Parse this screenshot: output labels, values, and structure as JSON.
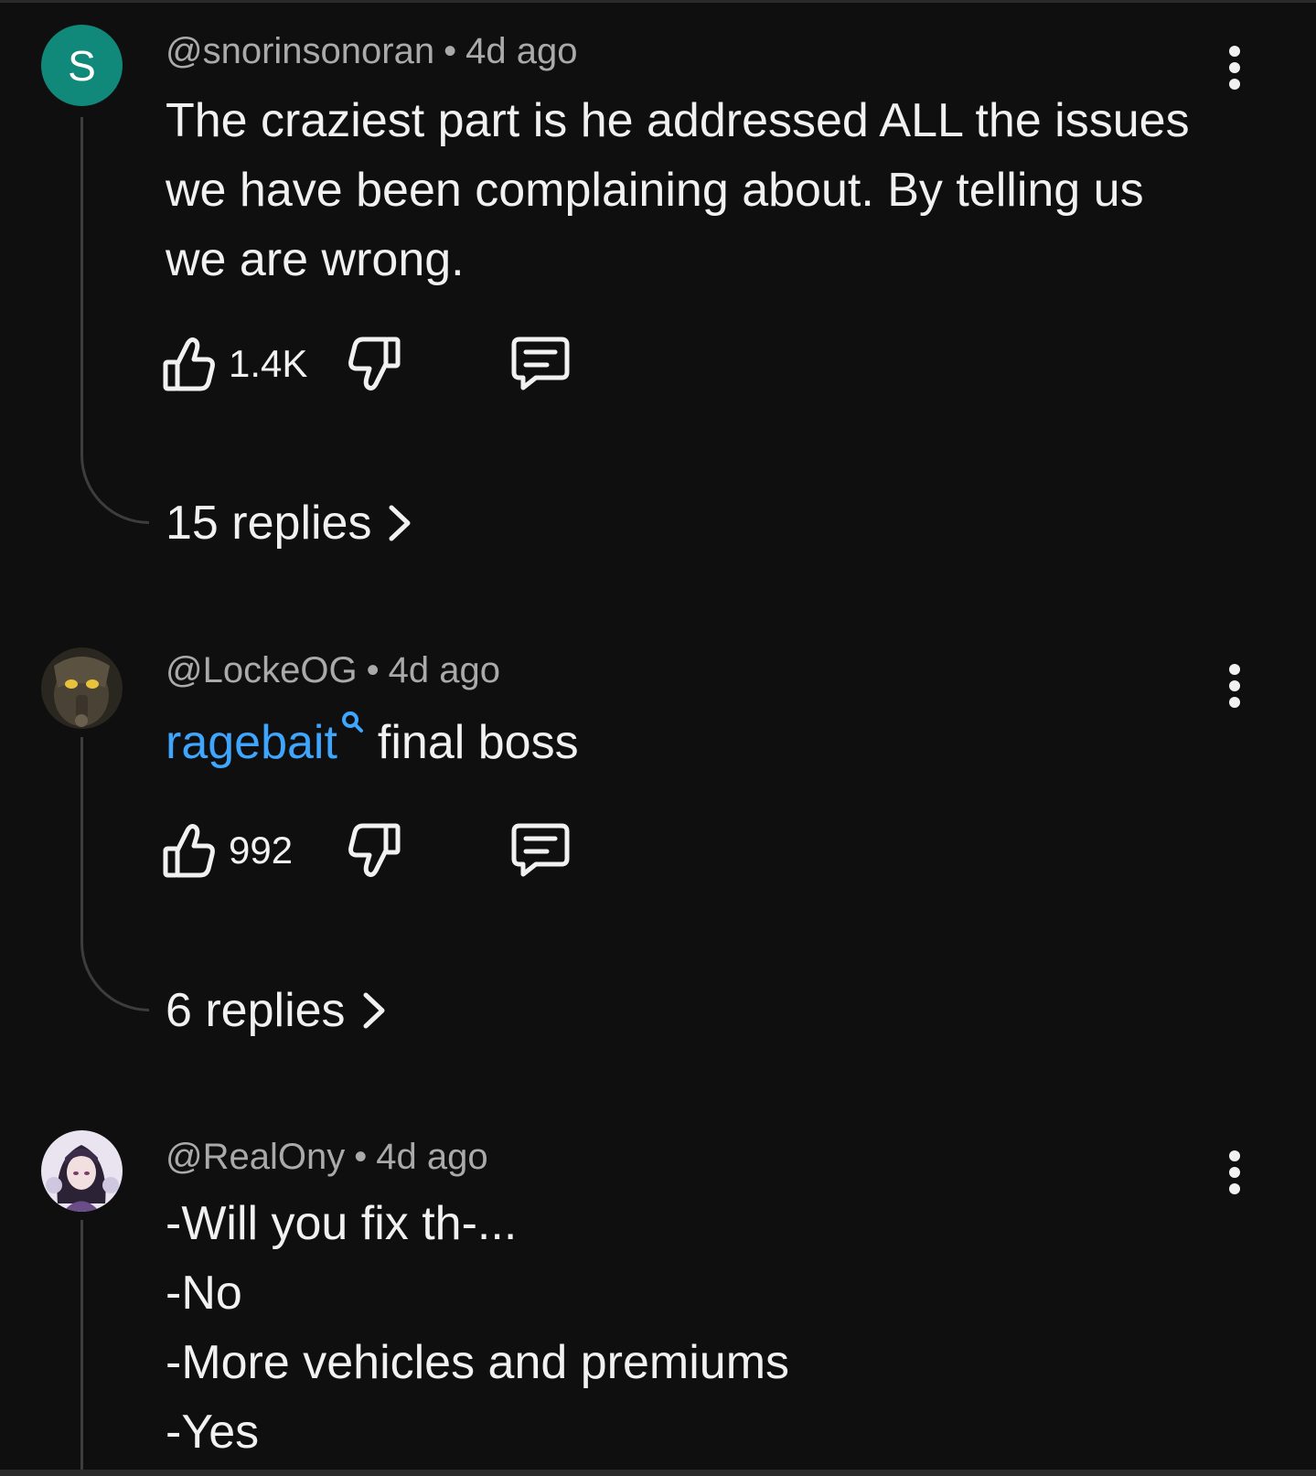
{
  "comments": [
    {
      "avatar_letter": "S",
      "avatar_color": "#11897a",
      "handle": "@snorinsonoran",
      "separator": "•",
      "time": "4d ago",
      "text_lines": [
        "The craziest part is he addressed ALL the issues",
        "we have been complaining about. By telling us",
        "we are wrong."
      ],
      "likes": "1.4K",
      "replies_label": "15 replies"
    },
    {
      "avatar_description": "avatar-locke",
      "handle": "@LockeOG",
      "separator": "•",
      "time": "4d ago",
      "hashtag": "ragebait",
      "text_after": "final boss",
      "likes": "992",
      "replies_label": "6 replies"
    },
    {
      "avatar_description": "avatar-realony",
      "handle": "@RealOny",
      "separator": "•",
      "time": "4d ago",
      "text_lines": [
        "-Will you fix th-...",
        "-No",
        "-More vehicles and premiums",
        "-Yes"
      ]
    }
  ],
  "icons": {
    "like": "thumbs-up-icon",
    "dislike": "thumbs-down-icon",
    "reply": "comment-icon",
    "more": "more-vertical-icon",
    "chevron": "chevron-right-icon",
    "search": "search-icon"
  },
  "colors": {
    "background": "#0f0f0f",
    "text": "#f1f1f1",
    "meta": "#aaaaaa",
    "link": "#3ea6ff"
  }
}
